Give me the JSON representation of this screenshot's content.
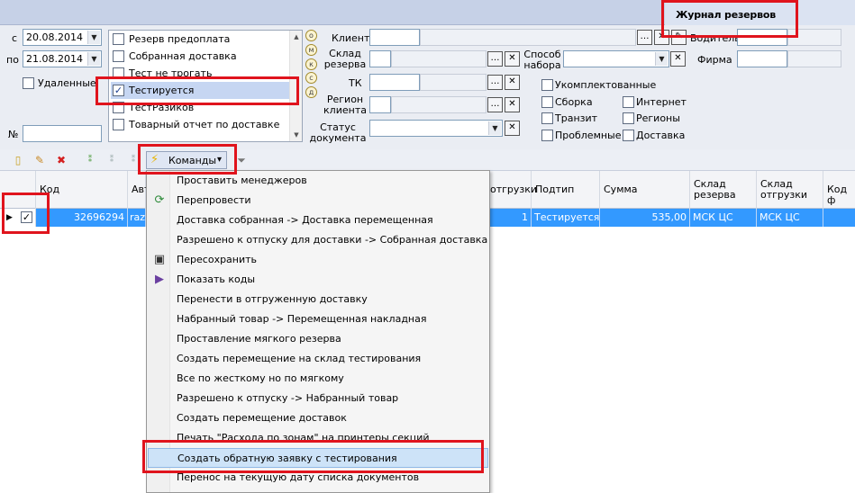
{
  "window": {
    "title": "Журнал резервов"
  },
  "filters": {
    "date_from_label": "с",
    "date_from": "20.08.2014",
    "date_to_label": "по",
    "date_to": "21.08.2014",
    "deleted_label": "Удаленные",
    "number_label": "№",
    "number_value": ""
  },
  "status_list": [
    {
      "label": "Резерв предоплата",
      "checked": false
    },
    {
      "label": "Собранная доставка",
      "checked": false
    },
    {
      "label": "Тест не трогать",
      "checked": false
    },
    {
      "label": "Тестируется",
      "checked": true
    },
    {
      "label": "ТестРазиков",
      "checked": false
    },
    {
      "label": "Товарный отчет по доставке",
      "checked": false
    }
  ],
  "side_letters": [
    "о",
    "м",
    "к",
    "с",
    "д"
  ],
  "fields": {
    "client": "Клиент",
    "warehouse_reserve": "Склад резерва",
    "tk": "ТК",
    "client_region": "Регион клиента",
    "doc_status": "Статус документа",
    "pick_method": "Способ набора",
    "driver": "Водитель",
    "company": "Фирма"
  },
  "checks": {
    "left": [
      "Укомплектованные",
      "Сборка",
      "Транзит",
      "Проблемные"
    ],
    "right": [
      "Интернет",
      "Регионы",
      "Доставка"
    ]
  },
  "toolbar": {
    "commands_label": "Команды",
    "commands_caret": "▾"
  },
  "grid": {
    "columns": [
      "Код",
      "Авт",
      "отгрузки",
      "Подтип",
      "Сумма",
      "Склад резерва",
      "Склад отгрузки",
      "Код ф"
    ],
    "row": {
      "code": "32696294",
      "author": "razi",
      "shipment": "1",
      "subtype": "Тестируется",
      "sum": "535,00",
      "warehouse_reserve": "МСК ЦС",
      "warehouse_ship": "МСК ЦС"
    }
  },
  "menu": {
    "items": [
      {
        "label": "Проставить менеджеров",
        "icon": ""
      },
      {
        "label": "Перепровести",
        "icon": "refresh-icon"
      },
      {
        "label": "Доставка собранная -> Доставка перемещенная",
        "icon": ""
      },
      {
        "label": "Разрешено к отпуску для доставки -> Собранная доставка",
        "icon": ""
      },
      {
        "label": "Пересохранить",
        "icon": "save-icon"
      },
      {
        "label": "Показать коды",
        "icon": "play-icon"
      },
      {
        "label": "Перенести в отгруженную доставку",
        "icon": ""
      },
      {
        "label": "Набранный товар -> Перемещенная накладная",
        "icon": ""
      },
      {
        "label": "Проставление мягкого резерва",
        "icon": ""
      },
      {
        "label": "Создать перемещение на склад тестирования",
        "icon": ""
      },
      {
        "label": "Все по жесткому но по мягкому",
        "icon": ""
      },
      {
        "label": "Разрешено к отпуску -> Набранный товар",
        "icon": ""
      },
      {
        "label": "Создать перемещение доставок",
        "icon": ""
      },
      {
        "label": "Печать \"Расхода по зонам\" на принтеры секций",
        "icon": ""
      },
      {
        "label": "Создать обратную заявку с тестирования",
        "icon": "",
        "highlighted": true
      },
      {
        "label": "Перенос на текущую дату списка документов",
        "icon": ""
      }
    ]
  },
  "colors": {
    "selection": "#3399ff",
    "annotation": "#e0141d",
    "menu_highlight": "#cde3f8"
  }
}
